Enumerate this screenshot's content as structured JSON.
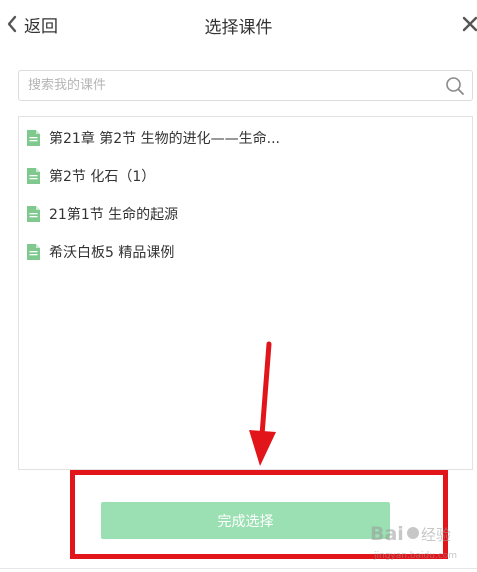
{
  "header": {
    "back_label": "返回",
    "title": "选择课件",
    "close_icon": "close-icon",
    "back_icon": "chevron-left-icon"
  },
  "search": {
    "placeholder": "搜索我的课件",
    "value": "",
    "icon": "search-icon"
  },
  "courseware_list": {
    "items": [
      {
        "label": "第21章 第2节 生物的进化——生命...",
        "icon": "document-icon"
      },
      {
        "label": "第2节 化石（1）",
        "icon": "document-icon"
      },
      {
        "label": "21第1节 生命的起源",
        "icon": "document-icon"
      },
      {
        "label": "希沃白板5 精品课例",
        "icon": "document-icon"
      }
    ]
  },
  "footer": {
    "confirm_label": "完成选择"
  },
  "annotation": {
    "highlight_color": "#e2151a",
    "arrow_color": "#e2151a"
  },
  "watermark": {
    "text": "Baidu经验",
    "subtext": "jingyan.baidu.com"
  },
  "colors": {
    "accent_green": "#9be0b3",
    "file_icon_green": "#7fc98f",
    "text_primary": "#333333",
    "placeholder": "#b5b5b5",
    "border": "#dcdcdc"
  }
}
